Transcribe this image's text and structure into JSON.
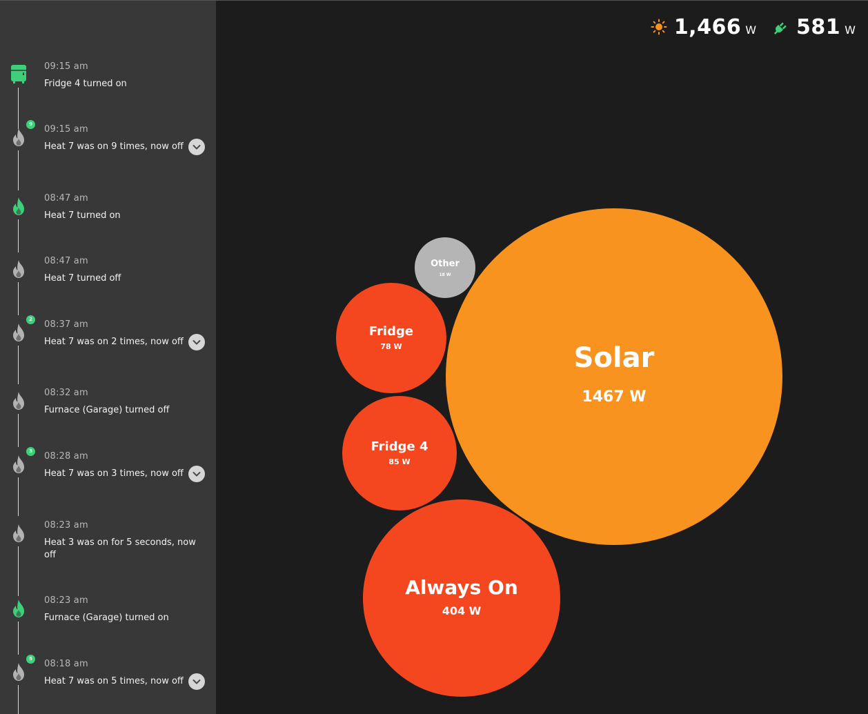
{
  "header": {
    "solar": {
      "value": "1,466",
      "unit": "W",
      "icon": "sun-icon",
      "color": "#f7931e"
    },
    "grid": {
      "value": "581",
      "unit": "W",
      "icon": "plug-icon",
      "color": "#3ecf7a"
    }
  },
  "colors": {
    "sidebar_bg": "#383838",
    "main_bg": "#1c1c1c",
    "accent_green": "#3ecf7a",
    "icon_gray": "#b3b3b3",
    "solar_orange": "#f7931e",
    "device_red": "#f5471f",
    "other_gray": "#b5b5b5"
  },
  "events": [
    {
      "time": "09:15 am",
      "text": "Fridge 4 turned on",
      "icon": "fridge-icon",
      "active": true,
      "badge": null,
      "expandable": false
    },
    {
      "time": "09:15 am",
      "text": "Heat 7 was on 9 times, now off",
      "icon": "flame-icon",
      "active": false,
      "badge": "9",
      "expandable": true
    },
    {
      "time": "08:47 am",
      "text": "Heat 7 turned on",
      "icon": "flame-icon",
      "active": true,
      "badge": null,
      "expandable": false
    },
    {
      "time": "08:47 am",
      "text": "Heat 7 turned off",
      "icon": "flame-icon",
      "active": false,
      "badge": null,
      "expandable": false
    },
    {
      "time": "08:37 am",
      "text": "Heat 7 was on 2 times, now off",
      "icon": "flame-icon",
      "active": false,
      "badge": "2",
      "expandable": true
    },
    {
      "time": "08:32 am",
      "text": "Furnace (Garage) turned off",
      "icon": "flame-icon",
      "active": false,
      "badge": null,
      "expandable": false
    },
    {
      "time": "08:28 am",
      "text": "Heat 7 was on 3 times, now off",
      "icon": "flame-icon",
      "active": false,
      "badge": "3",
      "expandable": true
    },
    {
      "time": "08:23 am",
      "text": "Heat 3 was on for 5 seconds, now off",
      "icon": "flame-icon",
      "active": false,
      "badge": null,
      "expandable": false
    },
    {
      "time": "08:23 am",
      "text": "Furnace (Garage) turned on",
      "icon": "flame-icon",
      "active": true,
      "badge": null,
      "expandable": false
    },
    {
      "time": "08:18 am",
      "text": "Heat 7 was on 5 times, now off",
      "icon": "flame-icon",
      "active": false,
      "badge": "5",
      "expandable": true
    }
  ],
  "bubbles": [
    {
      "name": "Solar",
      "value": "1467 W",
      "watts": 1467,
      "color": "#f7931e"
    },
    {
      "name": "Always On",
      "value": "404 W",
      "watts": 404,
      "color": "#f5471f"
    },
    {
      "name": "Fridge 4",
      "value": "85 W",
      "watts": 85,
      "color": "#f5471f"
    },
    {
      "name": "Fridge",
      "value": "78 W",
      "watts": 78,
      "color": "#f5471f"
    },
    {
      "name": "Other",
      "value": "18 W",
      "watts": 18,
      "color": "#b5b5b5"
    }
  ]
}
